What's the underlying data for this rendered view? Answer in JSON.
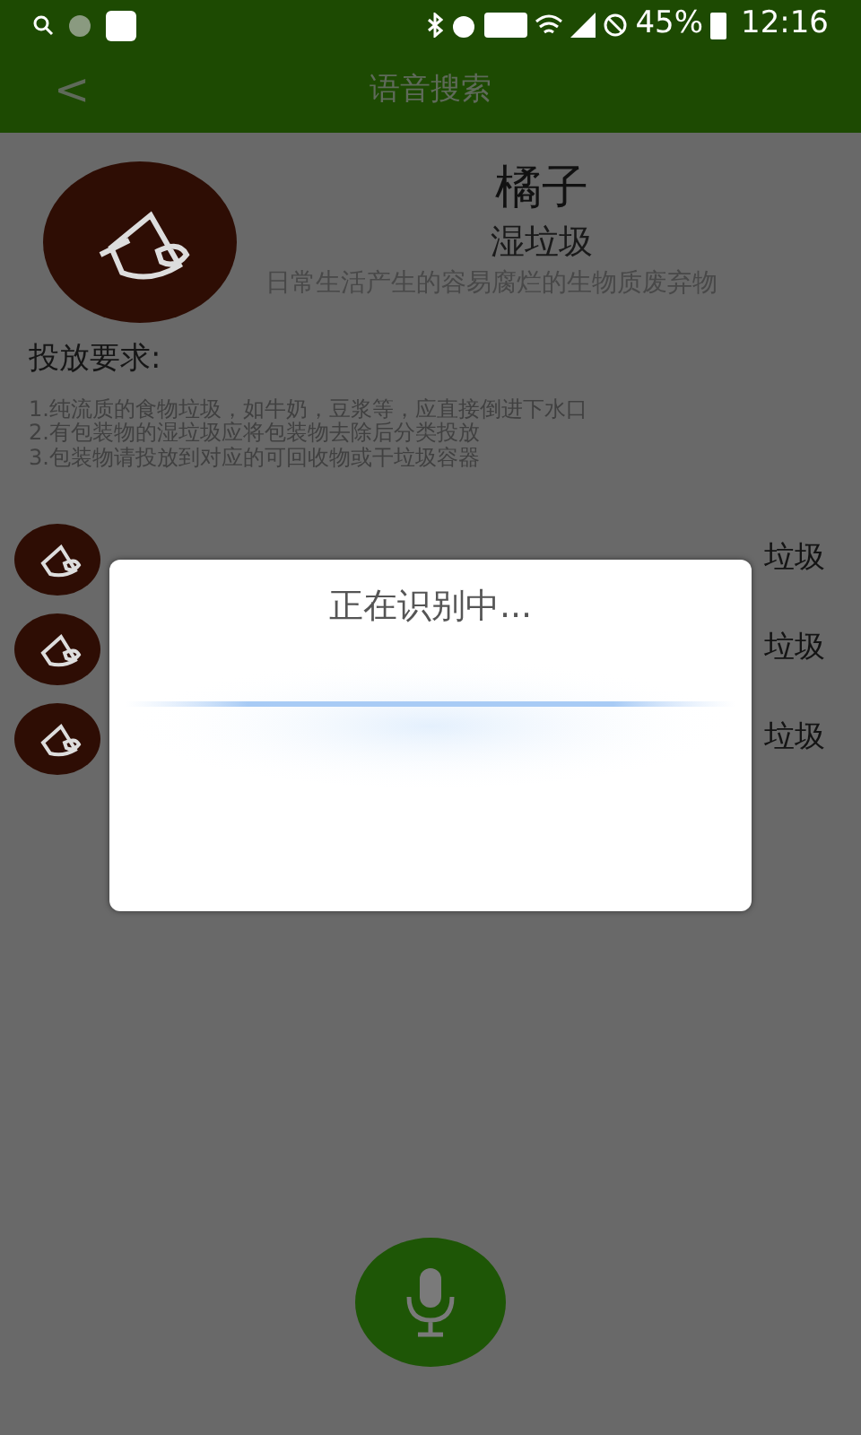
{
  "status_bar": {
    "battery": "45%",
    "time": "12:16"
  },
  "header": {
    "back": "<",
    "title": "语音搜索"
  },
  "item": {
    "name": "橘子",
    "category": "湿垃圾",
    "description": "日常生活产生的容易腐烂的生物质废弃物"
  },
  "requirements": {
    "heading": "投放要求:",
    "lines": [
      "1.纯流质的食物垃圾，如牛奶，豆浆等，应直接倒进下水口",
      "2.有包装物的湿垃圾应将包装物去除后分类投放",
      "3.包装物请投放到对应的可回收物或干垃圾容器"
    ]
  },
  "results": [
    {
      "category": "垃圾"
    },
    {
      "category": "垃圾"
    },
    {
      "category": "垃圾"
    }
  ],
  "dialog": {
    "title": "正在识别中..."
  }
}
